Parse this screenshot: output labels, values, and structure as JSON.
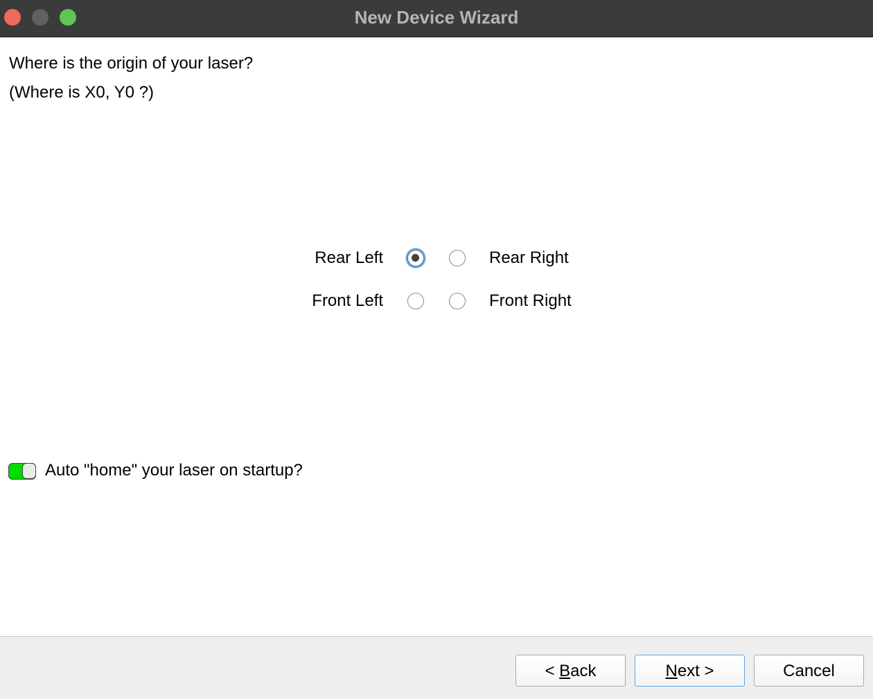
{
  "window": {
    "title": "New Device Wizard"
  },
  "question": {
    "line1": "Where is the origin of your laser?",
    "line2": "(Where is X0, Y0 ?)"
  },
  "origin_options": {
    "rear_left": {
      "label": "Rear Left",
      "selected": true
    },
    "rear_right": {
      "label": "Rear Right",
      "selected": false
    },
    "front_left": {
      "label": "Front Left",
      "selected": false
    },
    "front_right": {
      "label": "Front Right",
      "selected": false
    }
  },
  "auto_home": {
    "label": "Auto \"home\" your laser on startup?",
    "enabled": true,
    "on_color": "#00dd00"
  },
  "buttons": {
    "back": {
      "prefix": "< ",
      "mnemonic": "B",
      "rest": "ack"
    },
    "next": {
      "mnemonic": "N",
      "rest": "ext >"
    },
    "cancel": {
      "label": "Cancel"
    }
  },
  "colors": {
    "titlebar": "#3a3b3b",
    "focus_ring": "#5aa9ee",
    "close": "#ec6a5e",
    "minimize": "#5f6162",
    "maximize": "#61c554"
  }
}
